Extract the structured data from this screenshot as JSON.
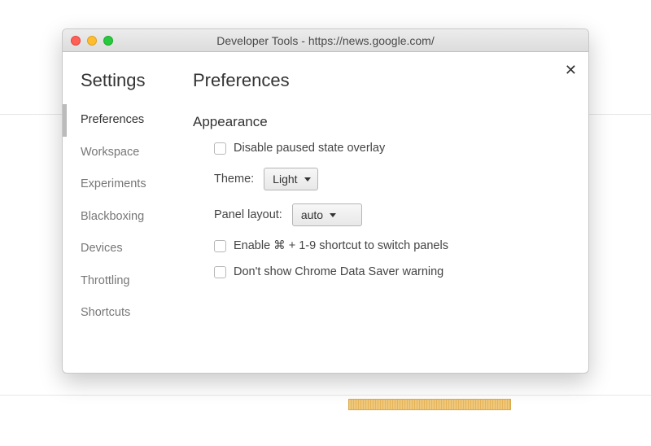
{
  "window": {
    "title": "Developer Tools - https://news.google.com/"
  },
  "sidebar": {
    "heading": "Settings",
    "items": [
      {
        "label": "Preferences",
        "active": true
      },
      {
        "label": "Workspace",
        "active": false
      },
      {
        "label": "Experiments",
        "active": false
      },
      {
        "label": "Blackboxing",
        "active": false
      },
      {
        "label": "Devices",
        "active": false
      },
      {
        "label": "Throttling",
        "active": false
      },
      {
        "label": "Shortcuts",
        "active": false
      }
    ]
  },
  "main": {
    "title": "Preferences",
    "close_symbol": "✕",
    "section": "Appearance",
    "checkbox_disable_overlay": "Disable paused state overlay",
    "theme_label": "Theme:",
    "theme_value": "Light",
    "panel_layout_label": "Panel layout:",
    "panel_layout_value": "auto",
    "checkbox_shortcut": "Enable ⌘ + 1-9 shortcut to switch panels",
    "checkbox_datasaver": "Don't show Chrome Data Saver warning"
  }
}
